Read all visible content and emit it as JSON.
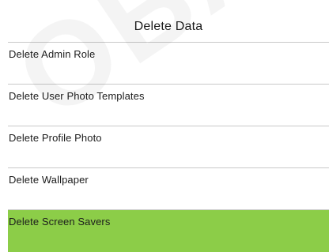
{
  "header": {
    "title": "Delete Data"
  },
  "menu": {
    "items": [
      {
        "label": "Delete Admin Role"
      },
      {
        "label": "Delete User Photo Templates"
      },
      {
        "label": "Delete Profile Photo"
      },
      {
        "label": "Delete Wallpaper"
      },
      {
        "label": "Delete Screen Savers",
        "selected": true
      }
    ]
  },
  "colors": {
    "selected_bg": "#8ccd48",
    "divider": "#c9c9c9",
    "text": "#1c1c1c"
  },
  "watermark": {
    "text": "OBAL"
  }
}
